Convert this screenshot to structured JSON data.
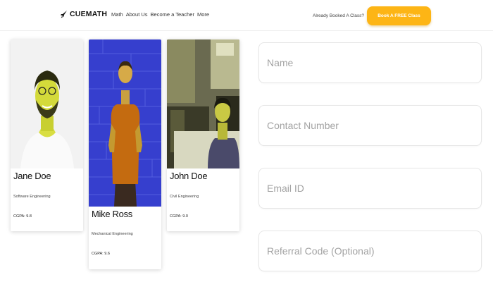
{
  "header": {
    "logo_text": "CUEMATH",
    "nav": [
      "Math",
      "About Us",
      "Become a Teacher",
      "More"
    ],
    "already_text": "Already Booked A Class?",
    "book_button": "Book A FREE Class",
    "accent_color": "#fdb515"
  },
  "cards": [
    {
      "name": "Jane Doe",
      "department": "Software Engineering",
      "cgpa": "CGPA: 9.8"
    },
    {
      "name": "Mike Ross",
      "department": "Mechanical Engineering",
      "cgpa": "CGPA: 9.6"
    },
    {
      "name": "John Doe",
      "department": "Civil Engineering",
      "cgpa": "CGPA: 9.0"
    }
  ],
  "form": {
    "name_placeholder": "Name",
    "contact_placeholder": "Contact Number",
    "email_placeholder": "Email ID",
    "referral_placeholder": "Referral Code (Optional)"
  }
}
